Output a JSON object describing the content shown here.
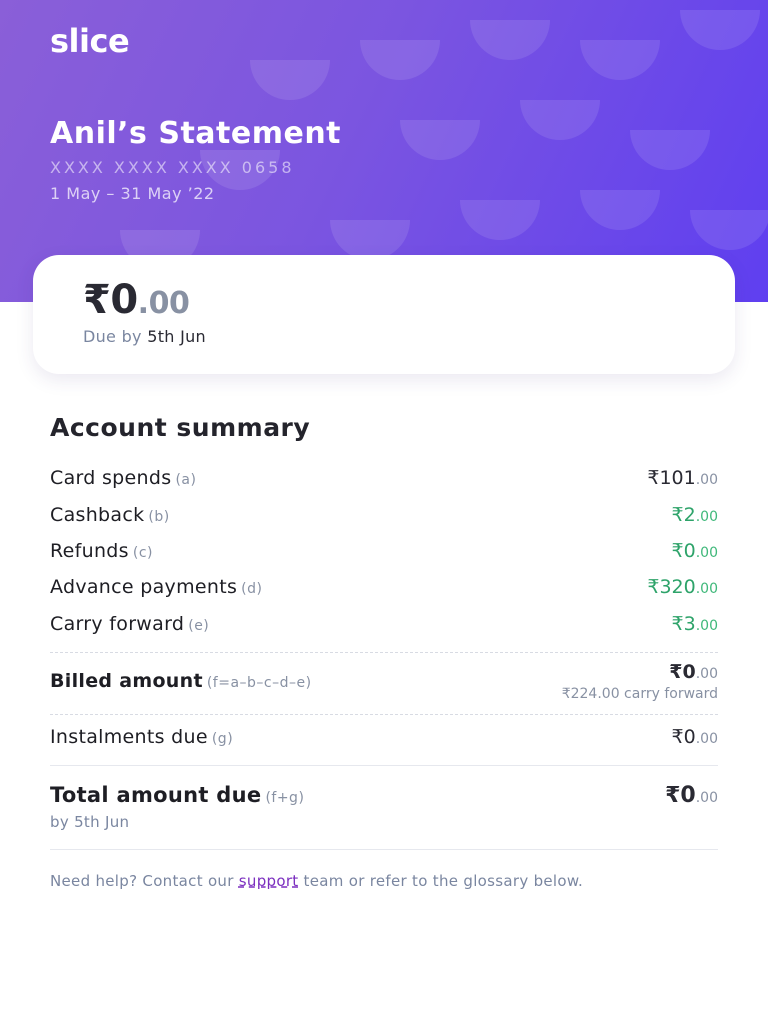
{
  "brand": "slice",
  "statement": {
    "title": "Anil’s Statement",
    "card_number": "XXXX XXXX XXXX 0658",
    "period": "1 May – 31 May ’22"
  },
  "due": {
    "amount_int": "₹0",
    "amount_dec": ".00",
    "due_by_label": "Due by",
    "due_by_date": "5th Jun"
  },
  "summary": {
    "title": "Account summary",
    "rows": [
      {
        "label": "Card spends",
        "tag": "(a)",
        "amount_int": "₹101",
        "amount_dec": ".00",
        "color": "#2a2a33"
      },
      {
        "label": "Cashback",
        "tag": "(b)",
        "amount_int": "₹2",
        "amount_dec": ".00",
        "color": "#2ea36a"
      },
      {
        "label": "Refunds",
        "tag": "(c)",
        "amount_int": "₹0",
        "amount_dec": ".00",
        "color": "#2ea36a"
      },
      {
        "label": "Advance payments",
        "tag": "(d)",
        "amount_int": "₹320",
        "amount_dec": ".00",
        "color": "#2ea36a"
      },
      {
        "label": "Carry forward",
        "tag": "(e)",
        "amount_int": "₹3",
        "amount_dec": ".00",
        "color": "#2ea36a"
      }
    ],
    "billed": {
      "label": "Billed amount",
      "tag": "(f=a–b–c–d–e)",
      "amount_int": "₹0",
      "amount_dec": ".00",
      "note": "₹224.00 carry forward"
    },
    "instalments": {
      "label": "Instalments due",
      "tag": "(g)",
      "amount_int": "₹0",
      "amount_dec": ".00"
    },
    "total": {
      "label": "Total amount due",
      "tag": "(f+g)",
      "amount_int": "₹0",
      "amount_dec": ".00",
      "by": "by 5th Jun"
    }
  },
  "help": {
    "prefix": "Need help? Contact our ",
    "link": "support",
    "suffix": " team or refer to the glossary below."
  },
  "colors": {
    "header_start": "#8a5fd8",
    "header_end": "#5f3ff0",
    "positive": "#2ea36a",
    "link": "#7b2fbf"
  }
}
